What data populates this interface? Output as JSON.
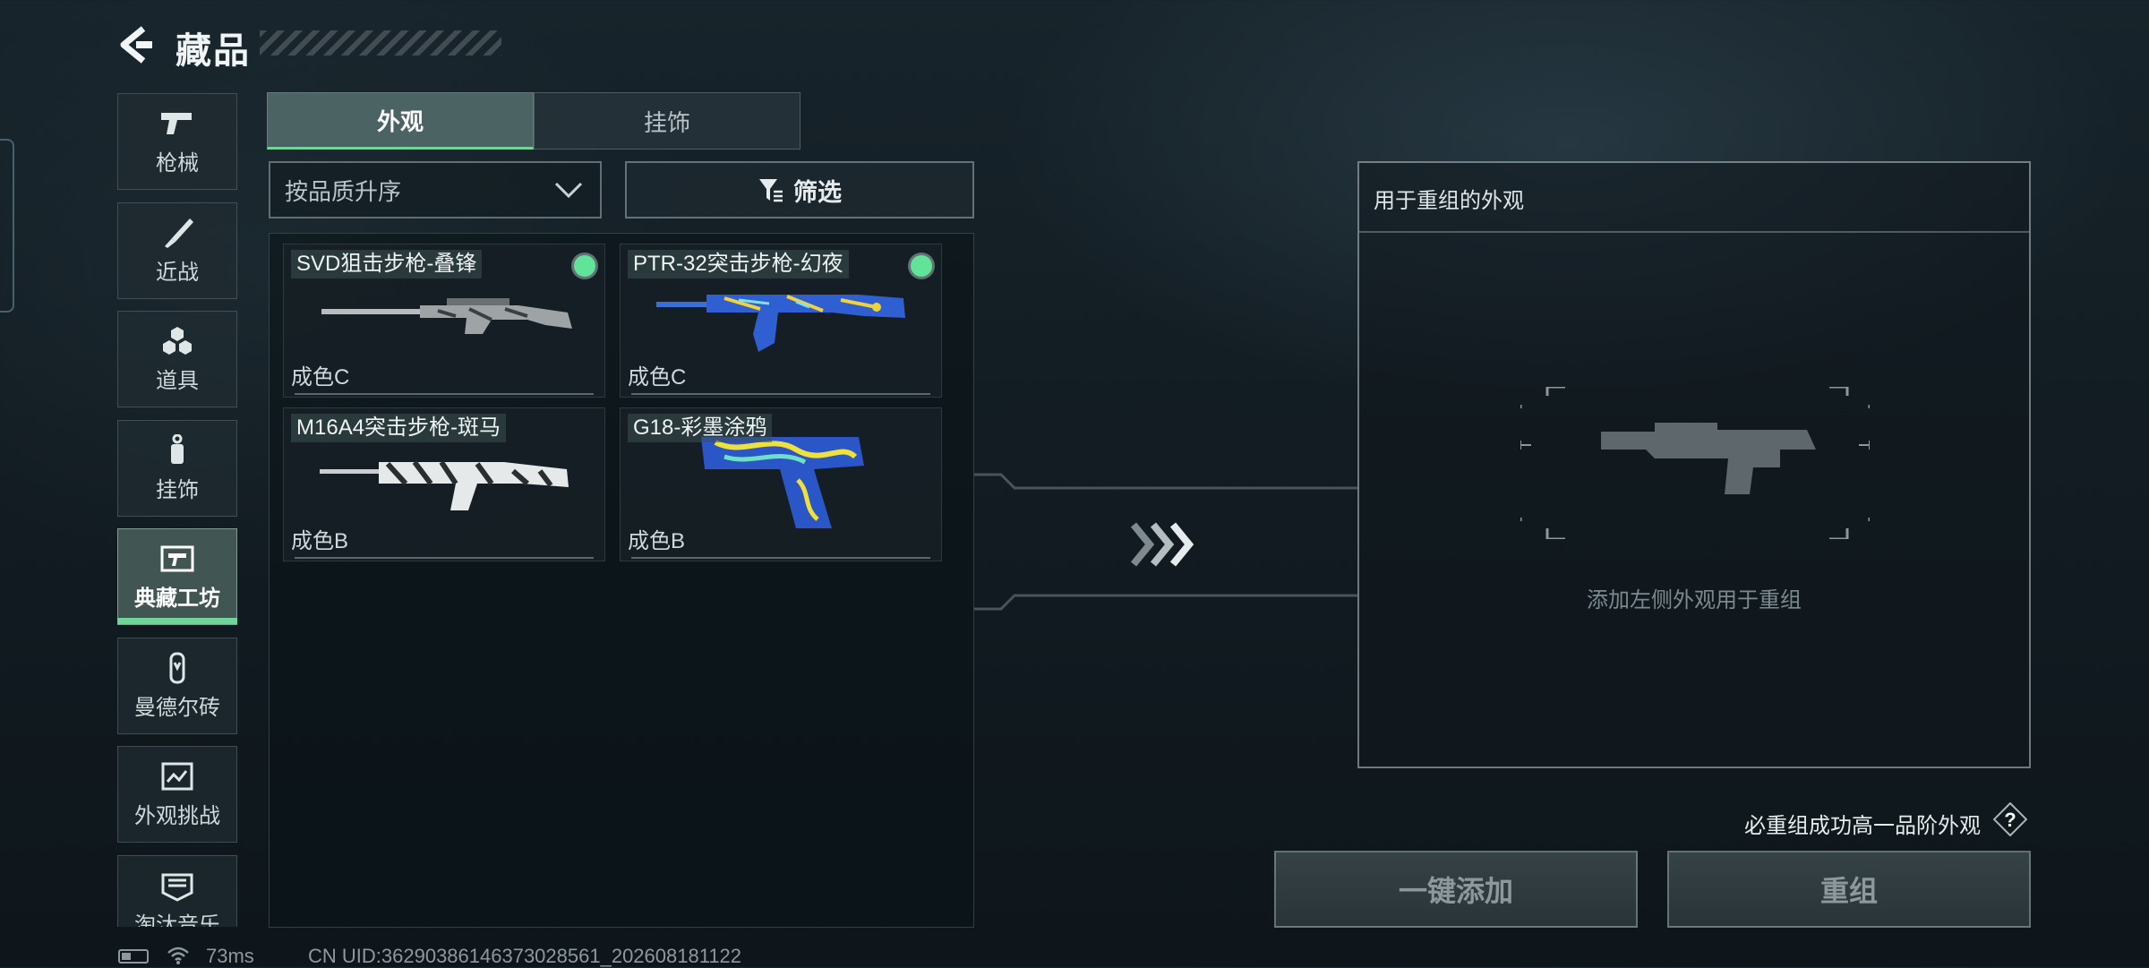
{
  "header": {
    "title": "藏品"
  },
  "sidebar": {
    "items": [
      {
        "label": "枪械",
        "icon": "pistol-icon"
      },
      {
        "label": "近战",
        "icon": "knife-icon"
      },
      {
        "label": "道具",
        "icon": "grenades-icon"
      },
      {
        "label": "挂饰",
        "icon": "charm-icon"
      },
      {
        "label": "典藏工坊",
        "icon": "workshop-icon",
        "active": true
      },
      {
        "label": "曼德尔砖",
        "icon": "mandel-brick-icon"
      },
      {
        "label": "外观挑战",
        "icon": "skin-challenge-icon"
      },
      {
        "label": "淘汰音乐",
        "icon": "badge-icon"
      }
    ]
  },
  "tabs": [
    {
      "label": "外观",
      "active": true
    },
    {
      "label": "挂饰",
      "active": false
    }
  ],
  "sort": {
    "value": "按品质升序"
  },
  "filter": {
    "label": "筛选"
  },
  "cards": [
    {
      "name": "SVD狙击步枪-叠锋",
      "grade": "成色C",
      "selected": true
    },
    {
      "name": "PTR-32突击步枪-幻夜",
      "grade": "成色C",
      "selected": true
    },
    {
      "name": "M16A4突击步枪-斑马",
      "grade": "成色B",
      "selected": false
    },
    {
      "name": "G18-彩墨涂鸦",
      "grade": "成色B",
      "selected": false
    }
  ],
  "recombine": {
    "title": "用于重组的外观",
    "hint": "添加左侧外观用于重组",
    "guarantee": "必重组成功高一品阶外观",
    "quick_add_label": "一键添加",
    "recombine_label": "重组"
  },
  "status": {
    "ping": "73ms",
    "uid": "CN UID:362903861463730285​61_202608181122"
  },
  "colors": {
    "accent_green": "#6fd59b",
    "selected_dot": "#62e39a"
  }
}
